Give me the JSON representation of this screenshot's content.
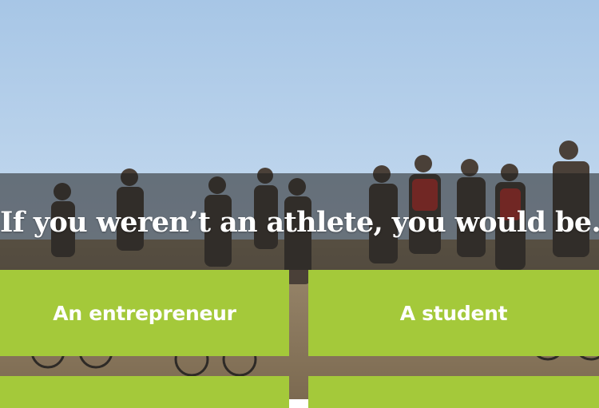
{
  "quiz": {
    "question": "If you weren’t an athlete, you would be...",
    "answers": [
      {
        "label": "An entrepreneur"
      },
      {
        "label": "A student"
      },
      {
        "label": ""
      },
      {
        "label": ""
      }
    ]
  },
  "colors": {
    "answer_background": "#a4c93a",
    "question_overlay": "#1e1e1e",
    "text": "#ffffff"
  }
}
